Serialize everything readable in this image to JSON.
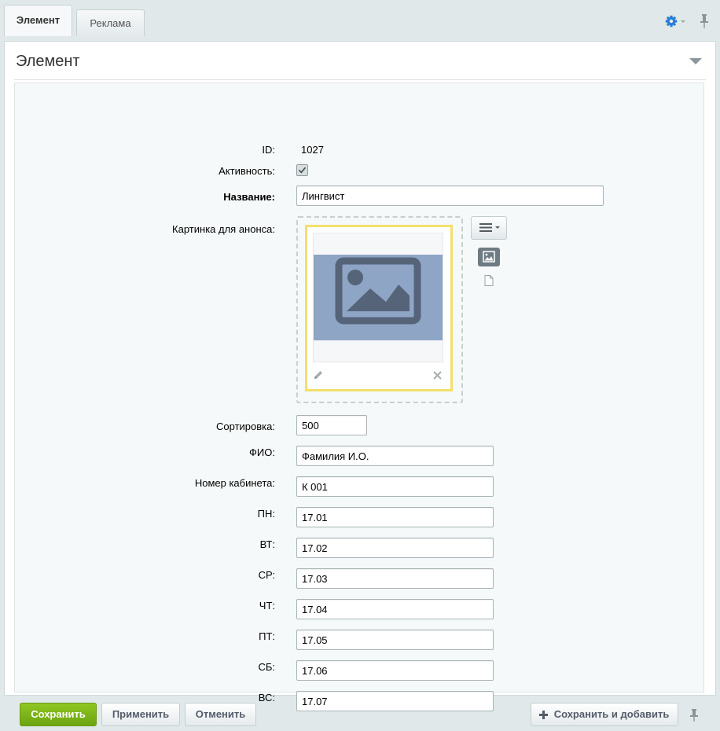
{
  "tabs": [
    {
      "label": "Элемент",
      "active": true
    },
    {
      "label": "Реклама",
      "active": false
    }
  ],
  "icons": {
    "settings": "gear-icon",
    "pin": "pin-icon",
    "collapse": "triangle-down-icon",
    "menu": "hamburger-icon",
    "image_mode": "image-icon",
    "file_mode": "file-icon",
    "edit": "pencil-icon",
    "remove": "close-icon",
    "add": "plus-icon"
  },
  "colors": {
    "accent_blue": "#2a7bd2",
    "save_green": "#7db31a",
    "image_placeholder": "#8fa5c6",
    "frame_highlight": "#f3df6c"
  },
  "panel": {
    "title": "Элемент"
  },
  "form": {
    "id": {
      "label": "ID:",
      "value": "1027"
    },
    "active": {
      "label": "Активность:",
      "checked": true
    },
    "name": {
      "label": "Название:",
      "value": "Лингвист"
    },
    "preview_picture": {
      "label": "Картинка для анонса:"
    },
    "sort": {
      "label": "Сортировка:",
      "value": "500"
    },
    "fio": {
      "label": "ФИО:",
      "value": "Фамилия И.О."
    },
    "room": {
      "label": "Номер кабинета:",
      "value": "К 001"
    },
    "days": [
      {
        "label": "ПН:",
        "value": "17.01"
      },
      {
        "label": "ВТ:",
        "value": "17.02"
      },
      {
        "label": "СР:",
        "value": "17.03"
      },
      {
        "label": "ЧТ:",
        "value": "17.04"
      },
      {
        "label": "ПТ:",
        "value": "17.05"
      },
      {
        "label": "СБ:",
        "value": "17.06"
      },
      {
        "label": "ВС:",
        "value": "17.07"
      }
    ]
  },
  "buttons": {
    "save": "Сохранить",
    "apply": "Применить",
    "cancel": "Отменить",
    "save_and_add": "Сохранить и добавить"
  }
}
